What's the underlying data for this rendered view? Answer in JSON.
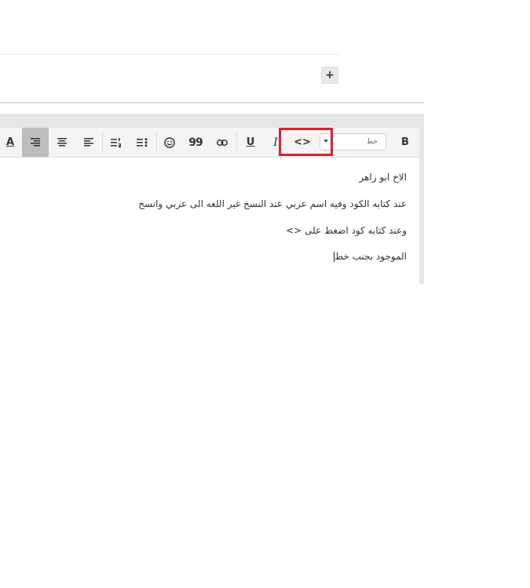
{
  "top": {
    "add_button_label": "+"
  },
  "toolbar": {
    "bold_label": "B",
    "italic_label": "I",
    "underline_label": "U",
    "quote_label": "99",
    "code_label": "<>",
    "text_color_label": "A",
    "font_select": {
      "selected": "خط"
    },
    "icons": [
      "text-color-icon",
      "align-right-icon",
      "align-center-icon",
      "align-left-icon",
      "ordered-list-icon",
      "unordered-list-icon",
      "smiley-icon",
      "quote-icon",
      "link-icon",
      "underline-icon",
      "italic-icon",
      "code-icon",
      "bold-icon"
    ],
    "highlight_color": "#d8232f"
  },
  "editor": {
    "lines": [
      "الاخ ابو زاهر",
      "عند كتابه الكود وفيه اسم عربي عند النسخ غير اللغه الى عربي وانسخ",
      "وعند كتابه كود اضغط على <>",
      "الموجود بجنب خط"
    ]
  }
}
